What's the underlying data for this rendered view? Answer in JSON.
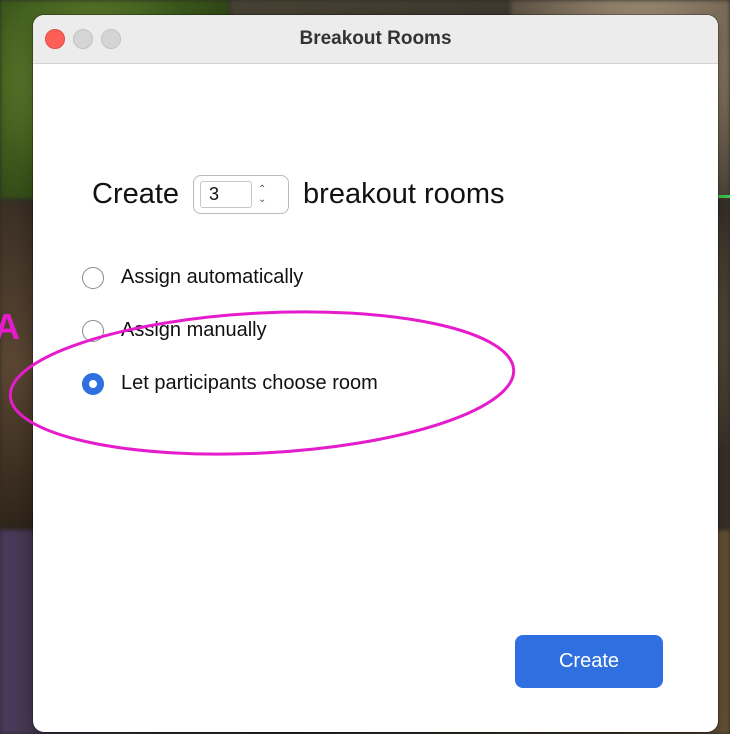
{
  "window": {
    "title": "Breakout Rooms"
  },
  "traffic_lights": {
    "close": "close-icon",
    "minimize": "minimize-icon",
    "zoom": "zoom-icon"
  },
  "create_row": {
    "prefix": "Create",
    "room_count": "3",
    "suffix": "breakout rooms"
  },
  "assign_options": [
    {
      "label": "Assign automatically",
      "selected": false
    },
    {
      "label": "Assign manually",
      "selected": false
    },
    {
      "label": "Let participants choose room",
      "selected": true
    }
  ],
  "create_button": {
    "label": "Create"
  },
  "annotation": {
    "letter": "A",
    "color": "#e41ccc"
  },
  "colors": {
    "accent": "#2f6fe0",
    "close": "#fd5f57"
  }
}
